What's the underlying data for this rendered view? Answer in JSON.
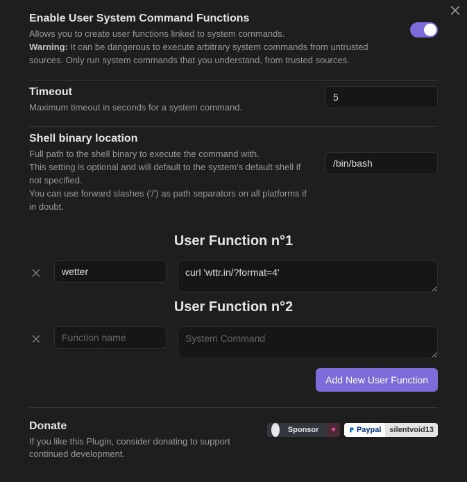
{
  "close_icon": "close",
  "settings": {
    "enable": {
      "title": "Enable User System Command Functions",
      "desc1": "Allows you to create user functions linked to system commands.",
      "warn_label": "Warning:",
      "warn_text": " It can be dangerous to execute arbitrary system commands from untrusted sources. Only run system commands that you understand, from trusted sources.",
      "on": true
    },
    "timeout": {
      "title": "Timeout",
      "desc": "Maximum timeout in seconds for a system command.",
      "value": "5"
    },
    "shell": {
      "title": "Shell binary location",
      "desc1": "Full path to the shell binary to execute the command with.",
      "desc2": "This setting is optional and will default to the system's default shell if not specified.",
      "desc3": "You can use forward slashes ('/') as path separators on all platforms if in doubt.",
      "value": "/bin/bash"
    }
  },
  "uf": {
    "heading1": "User Function n°1",
    "heading2": "User Function n°2",
    "name_placeholder": "Function name",
    "cmd_placeholder": "System Command",
    "items": [
      {
        "name": "wetter",
        "cmd": "curl 'wttr.in/?format=4'"
      },
      {
        "name": "",
        "cmd": ""
      }
    ],
    "add_label": "Add New User Function"
  },
  "donate": {
    "title": "Donate",
    "desc": "If you like this Plugin, consider donating to support continued development.",
    "sponsor_label": "Sponsor",
    "paypal_label": "Paypal",
    "paypal_user": "silentvoid13"
  }
}
